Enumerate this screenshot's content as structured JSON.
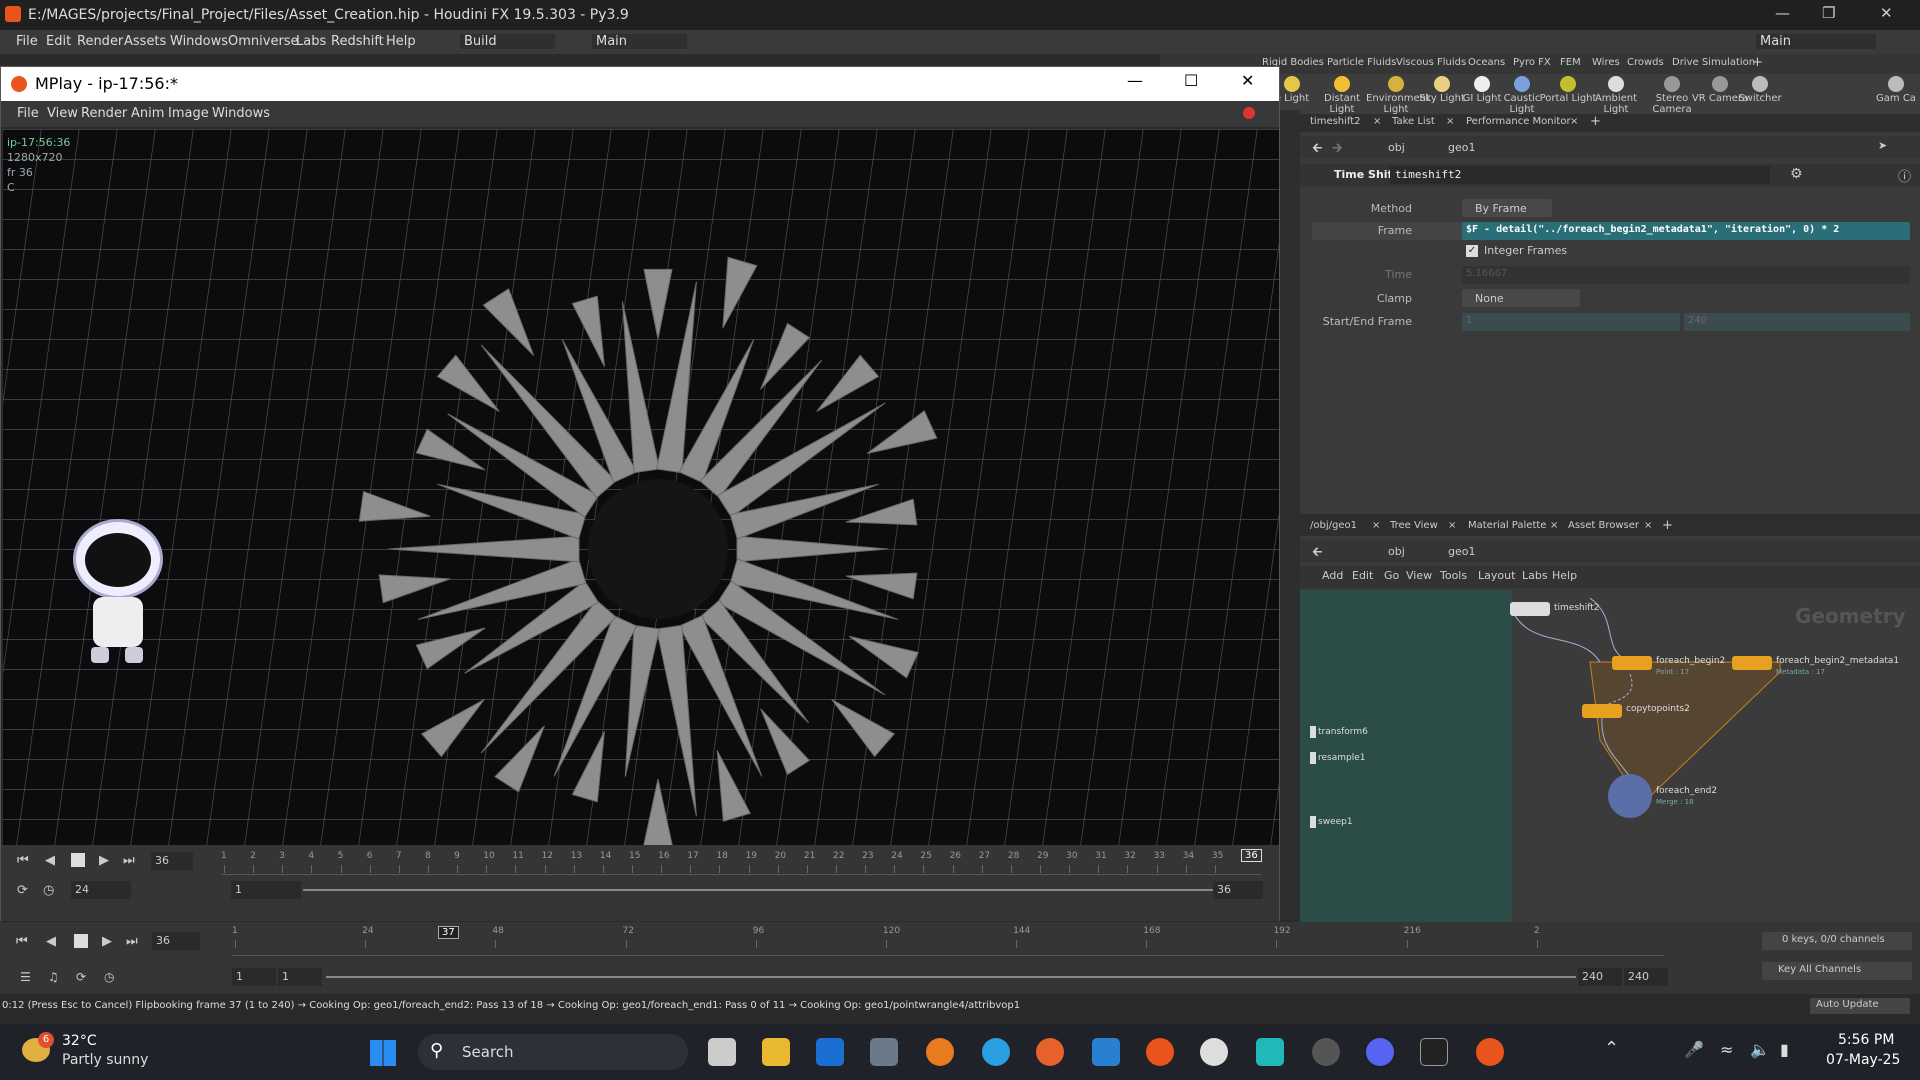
{
  "window": {
    "title": "E:/MAGES/projects/Final_Project/Files/Asset_Creation.hip - Houdini FX 19.5.303 - Py3.9"
  },
  "menubar": {
    "items": [
      "File",
      "Edit",
      "Render",
      "Assets",
      "Windows",
      "Omniverse",
      "Labs",
      "Redshift",
      "Help"
    ],
    "desktop_build": "Build",
    "desktop_main": "Main",
    "desktop_right": "Main"
  },
  "shelf": {
    "tabs": [
      "Rigid Bodies",
      "Particle Fluids",
      "Viscous Fluids",
      "Oceans",
      "Pyro FX",
      "FEM",
      "Wires",
      "Crowds",
      "Drive Simulation",
      "+"
    ],
    "tools": [
      "e Light",
      "Distant Light",
      "Environment Light",
      "Sky Light",
      "GI Light",
      "Caustic Light",
      "Portal Light",
      "Ambient Light",
      "Stereo Camera",
      "VR Camera",
      "Switcher",
      "Gam Ca"
    ]
  },
  "mplay": {
    "title": "MPlay - ip-17:56:*",
    "menu": [
      "File",
      "View",
      "Render",
      "Anim",
      "Image",
      "Windows"
    ],
    "info": [
      "ip-17:56:36",
      "1280x720",
      "fr 36",
      "C"
    ],
    "timeline_ticks": [
      "1",
      "2",
      "3",
      "4",
      "5",
      "6",
      "7",
      "8",
      "9",
      "10",
      "11",
      "12",
      "13",
      "14",
      "15",
      "16",
      "17",
      "18",
      "19",
      "20",
      "21",
      "22",
      "23",
      "24",
      "25",
      "26",
      "27",
      "28",
      "29",
      "30",
      "31",
      "32",
      "33",
      "34",
      "35"
    ],
    "current_frame": "36",
    "frame_end_marker": "36",
    "fps": "24",
    "range_start": "1",
    "range_end": "36"
  },
  "main_timeline": {
    "frame": "36",
    "cursor_frame": "37",
    "ticks": [
      "1",
      "24",
      "48",
      "72",
      "96",
      "120",
      "144",
      "168",
      "192",
      "216",
      "2"
    ],
    "start": "1",
    "start2": "1",
    "end": "240",
    "end2": "240",
    "keys_info": "0 keys, 0/0 channels",
    "key_all": "Key All Channels",
    "auto_update": "Auto Update"
  },
  "status": {
    "text": "0:12 (Press Esc to Cancel) Flipbooking frame 37 (1 to 240) → Cooking Op:  geo1/foreach_end2: Pass 13 of 18 → Cooking Op:  geo1/foreach_end1: Pass 0 of 11 → Cooking Op:  geo1/pointwrangle4/attribvop1"
  },
  "params": {
    "tabs": [
      "timeshift2",
      "Take List",
      "Performance Monitor",
      "+"
    ],
    "path_obj": "obj",
    "path_geo": "geo1",
    "node_type": "Time Shift",
    "node_name": "timeshift2",
    "method_label": "Method",
    "method_value": "By Frame",
    "frame_label": "Frame",
    "frame_value": "$F - detail(\"../foreach_begin2_metadata1\", \"iteration\", 0) * 2",
    "integer_frames": "Integer Frames",
    "time_label": "Time",
    "time_value": "5.16667",
    "clamp_label": "Clamp",
    "clamp_value": "None",
    "startend_label": "Start/End Frame",
    "start_value": "1",
    "end_value": "240"
  },
  "network": {
    "tabs": [
      "/obj/geo1",
      "Tree View",
      "Material Palette",
      "Asset Browser",
      "+"
    ],
    "path_obj": "obj",
    "path_geo": "geo1",
    "menu": [
      "Add",
      "Edit",
      "Go",
      "View",
      "Tools",
      "Layout",
      "Labs",
      "Help"
    ],
    "watermark": "Geometry",
    "nodes": {
      "timeshift2": "timeshift2",
      "foreach_begin2": "foreach_begin2",
      "foreach_begin2_sub": "Point : 17",
      "foreach_begin2_metadata1": "foreach_begin2_metadata1",
      "metadata_sub": "Metadata : 17",
      "copytopoints2": "copytopoints2",
      "foreach_end2": "foreach_end2",
      "foreach_end2_sub": "Merge : 18",
      "transform6": "transform6",
      "resample1": "resample1",
      "sweep1": "sweep1"
    }
  },
  "taskbar": {
    "weather_temp": "32°C",
    "weather_desc": "Partly sunny",
    "weather_badge": "6",
    "search": "Search",
    "time": "5:56 PM",
    "date": "07-May-25"
  }
}
